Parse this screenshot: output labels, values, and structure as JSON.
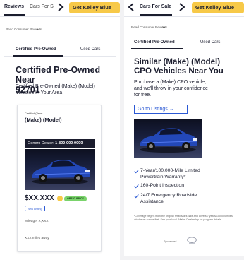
{
  "left": {
    "nav": {
      "reviews": "Reviews",
      "cars_for_sale": "Cars For S",
      "kbb_cta": "Get Kelley Blue"
    },
    "read_reviews": "Read Consumer Reviews",
    "tabs": [
      "Certified Pre-Owned",
      "Used Cars"
    ],
    "headline": [
      "Certified Pre-Owned Near",
      "92701"
    ],
    "subtext": [
      "Certified Pre-Owned (Make) (Model)",
      "Vehicles In Your Area"
    ],
    "card": {
      "year": "Certified (Year)",
      "model": "(Make) (Model)",
      "dealer_label": "Genero Dealer:",
      "dealer_phone": "1-800-000-0000",
      "price": "$XX,XXX",
      "deal_badge": "GREAT PRICE",
      "new_listing": "New Listing",
      "mileage": "Mileage: X,XXX",
      "distance": "XXX miles away"
    }
  },
  "right": {
    "nav": {
      "cars_for_sale": "Cars For Sale",
      "kbb_cta": "Get Kelley Blue"
    },
    "read_reviews": "Read Consumer Reviews",
    "tabs": [
      "Certified Pre-Owned",
      "Used Cars"
    ],
    "headline": [
      "Similar (Make) (Model)",
      "CPO Vehicles Near You"
    ],
    "subtext": [
      "Purchase a (Make) CPO vehicle,",
      "and we'll throw in your confidence",
      "for free."
    ],
    "cta": "Go to Listings →",
    "benefits": [
      [
        "7-Year/100,000-Mile Limited",
        "Powertrain Warranty*"
      ],
      [
        "160-Point Inspection"
      ],
      [
        "24/7 Emergency Roadside",
        "Assistance"
      ]
    ],
    "footnote": "*Coverage begins from the original retail sales date and covers 7 years/100,000 miles, whichever comes first. See your local (Make) Dealership for program details.",
    "sponsored": "Sponsored"
  },
  "colors": {
    "accent_blue": "#2a58d4",
    "kbb_yellow": "#f7c948",
    "deal_green": "#7ad36b",
    "ink": "#1b1d2e"
  }
}
